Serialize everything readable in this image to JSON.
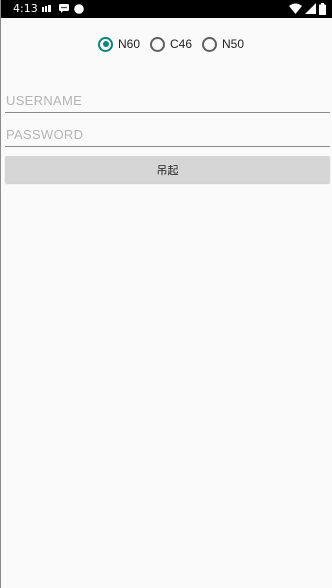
{
  "status_bar": {
    "time": "4:13",
    "icons": [
      "sim-card-icon",
      "message-icon",
      "circle-notification-icon",
      "wifi-icon",
      "cell-signal-icon",
      "battery-icon"
    ]
  },
  "radio_group": {
    "options": [
      {
        "label": "N60",
        "checked": true
      },
      {
        "label": "C46",
        "checked": false
      },
      {
        "label": "N50",
        "checked": false
      }
    ]
  },
  "form": {
    "username_placeholder": "USERNAME",
    "username_value": "",
    "password_placeholder": "PASSWORD",
    "password_value": "",
    "submit_label": "吊起"
  },
  "colors": {
    "accent": "#0b8577",
    "background": "#fafafa",
    "button_bg": "#d6d6d6",
    "status_bar_bg": "#000000"
  }
}
